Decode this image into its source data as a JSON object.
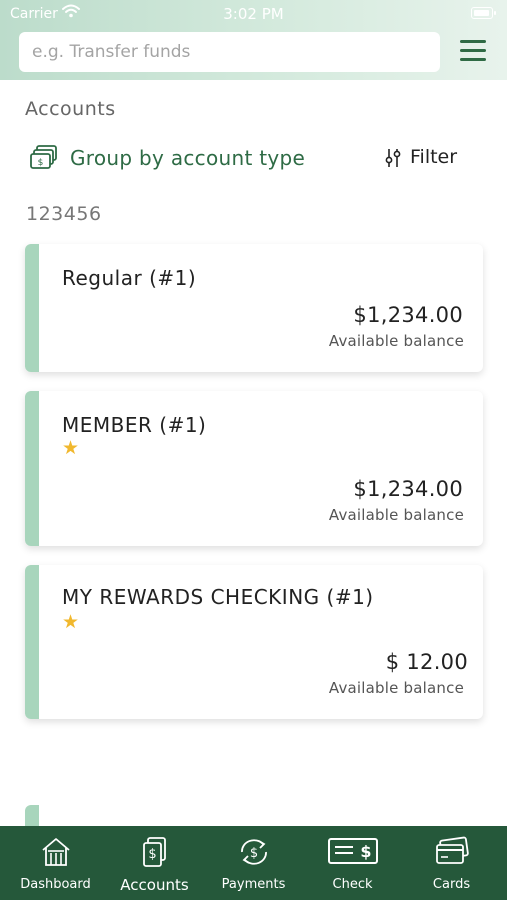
{
  "status_bar": {
    "carrier": "Carrier",
    "time": "3:02 PM"
  },
  "search": {
    "placeholder": "e.g. Transfer funds",
    "value": ""
  },
  "section_title": "Accounts",
  "group_by_label": "Group by account type",
  "filter_label": "Filter",
  "account_group": "123456",
  "accounts": [
    {
      "name": "Regular (#1)",
      "favorite": false,
      "balance": "$1,234.00",
      "balance_label": "Available balance"
    },
    {
      "name": "MEMBER (#1)",
      "favorite": true,
      "star": "★",
      "balance": "$1,234.00",
      "balance_label": "Available balance"
    },
    {
      "name": "MY REWARDS CHECKING (#1)",
      "favorite": true,
      "star": "★",
      "balance": "$ 12.00",
      "balance_label": "Available balance"
    }
  ],
  "tabs": [
    {
      "label": "Dashboard",
      "icon": "home-icon"
    },
    {
      "label": "Accounts",
      "icon": "document-dollar-icon"
    },
    {
      "label": "Payments",
      "icon": "refresh-dollar-icon"
    },
    {
      "label": "Check",
      "icon": "check-icon"
    },
    {
      "label": "Cards",
      "icon": "credit-card-icon"
    }
  ],
  "colors": {
    "brand_green": "#2e6b45",
    "tabbar": "#25583a",
    "accent_bar": "#a8d5bc",
    "star": "#f1b82e",
    "header_gradient_start": "#bcdccb"
  }
}
